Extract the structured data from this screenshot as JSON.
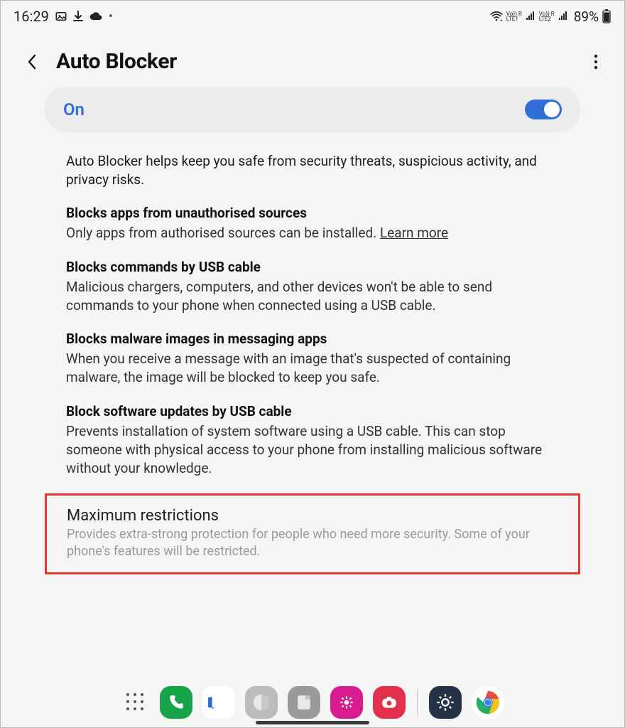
{
  "status_bar": {
    "time": "16:29",
    "battery_pct": "89%",
    "sim1": "Vo)) R\nLTE1",
    "sim2": "Vo)) R\nLTE2"
  },
  "header": {
    "title": "Auto Blocker"
  },
  "toggle": {
    "label": "On",
    "state": "on"
  },
  "intro": "Auto Blocker helps keep you safe from security threats, suspicious activity, and privacy risks.",
  "sections": [
    {
      "title": "Blocks apps from unauthorised sources",
      "body": "Only apps from authorised sources can be installed. ",
      "learn_more": "Learn more"
    },
    {
      "title": "Blocks commands by USB cable",
      "body": "Malicious chargers, computers, and other devices won't be able to send commands to your phone when connected using a USB cable."
    },
    {
      "title": "Blocks malware images in messaging apps",
      "body": "When you receive a message with an image that's suspected of containing malware, the image will be blocked to keep you safe."
    },
    {
      "title": "Block software updates by USB cable",
      "body": "Prevents installation of system software using a USB cable. This can stop someone with physical access to your phone from installing malicious software without your knowledge."
    }
  ],
  "max_restrictions": {
    "title": "Maximum restrictions",
    "body": "Provides extra-strong protection for people who need more security. Some of your phone's features will be restricted."
  }
}
